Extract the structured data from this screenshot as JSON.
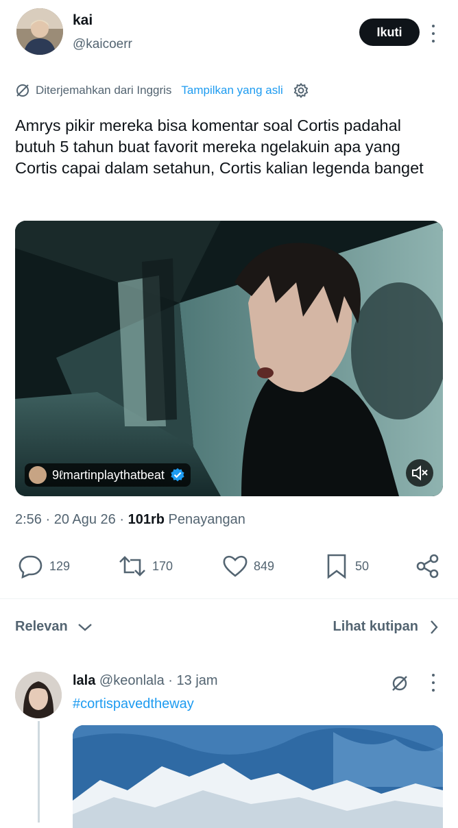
{
  "tweet": {
    "author_name": "kai",
    "author_handle": "@kaicoerr",
    "follow_label": "Ikuti",
    "translation_label": "Diterjemahkan dari Inggris",
    "show_original_label": "Tampilkan yang asli",
    "text": "Amrys pikir mereka bisa komentar soal Cortis padahal butuh 5 tahun buat favorit mereka ngelakuin apa yang Cortis capai dalam setahun, Cortis kalian legenda banget",
    "media_credit": "9ℓmartinplaythatbeat",
    "time": "2:56",
    "date": "20 Agu 26",
    "views_count": "101rb",
    "views_label": "Penayangan",
    "replies": "129",
    "reposts": "170",
    "likes": "849",
    "bookmarks": "50"
  },
  "sort": {
    "label": "Relevan",
    "quotes_label": "Lihat kutipan"
  },
  "reply": {
    "name": "lala",
    "handle": "@keonlala",
    "time": "13 jam",
    "hashtag": "#cortispavedtheway"
  },
  "colors": {
    "accent": "#1d9bf0",
    "text": "#0f1419",
    "muted": "#536471"
  }
}
